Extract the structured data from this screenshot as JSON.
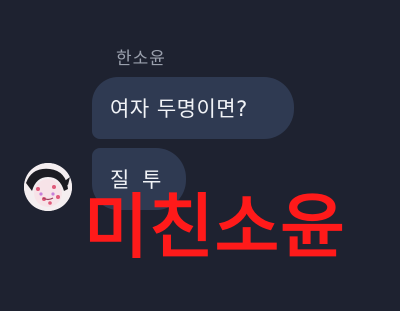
{
  "chat": {
    "sender_name": "한소윤",
    "messages": [
      {
        "text": "여자 두명이면?"
      },
      {
        "text": "질 투"
      }
    ],
    "avatar_icon": "profile-avatar-cartoon"
  },
  "overlay": {
    "caption": "미친소윤",
    "color": "#ff1a1a"
  },
  "colors": {
    "background": "#1e2230",
    "bubble": "#2f3a52",
    "bubble_text": "#f1f3f7",
    "name_text": "#9aa0ad"
  }
}
